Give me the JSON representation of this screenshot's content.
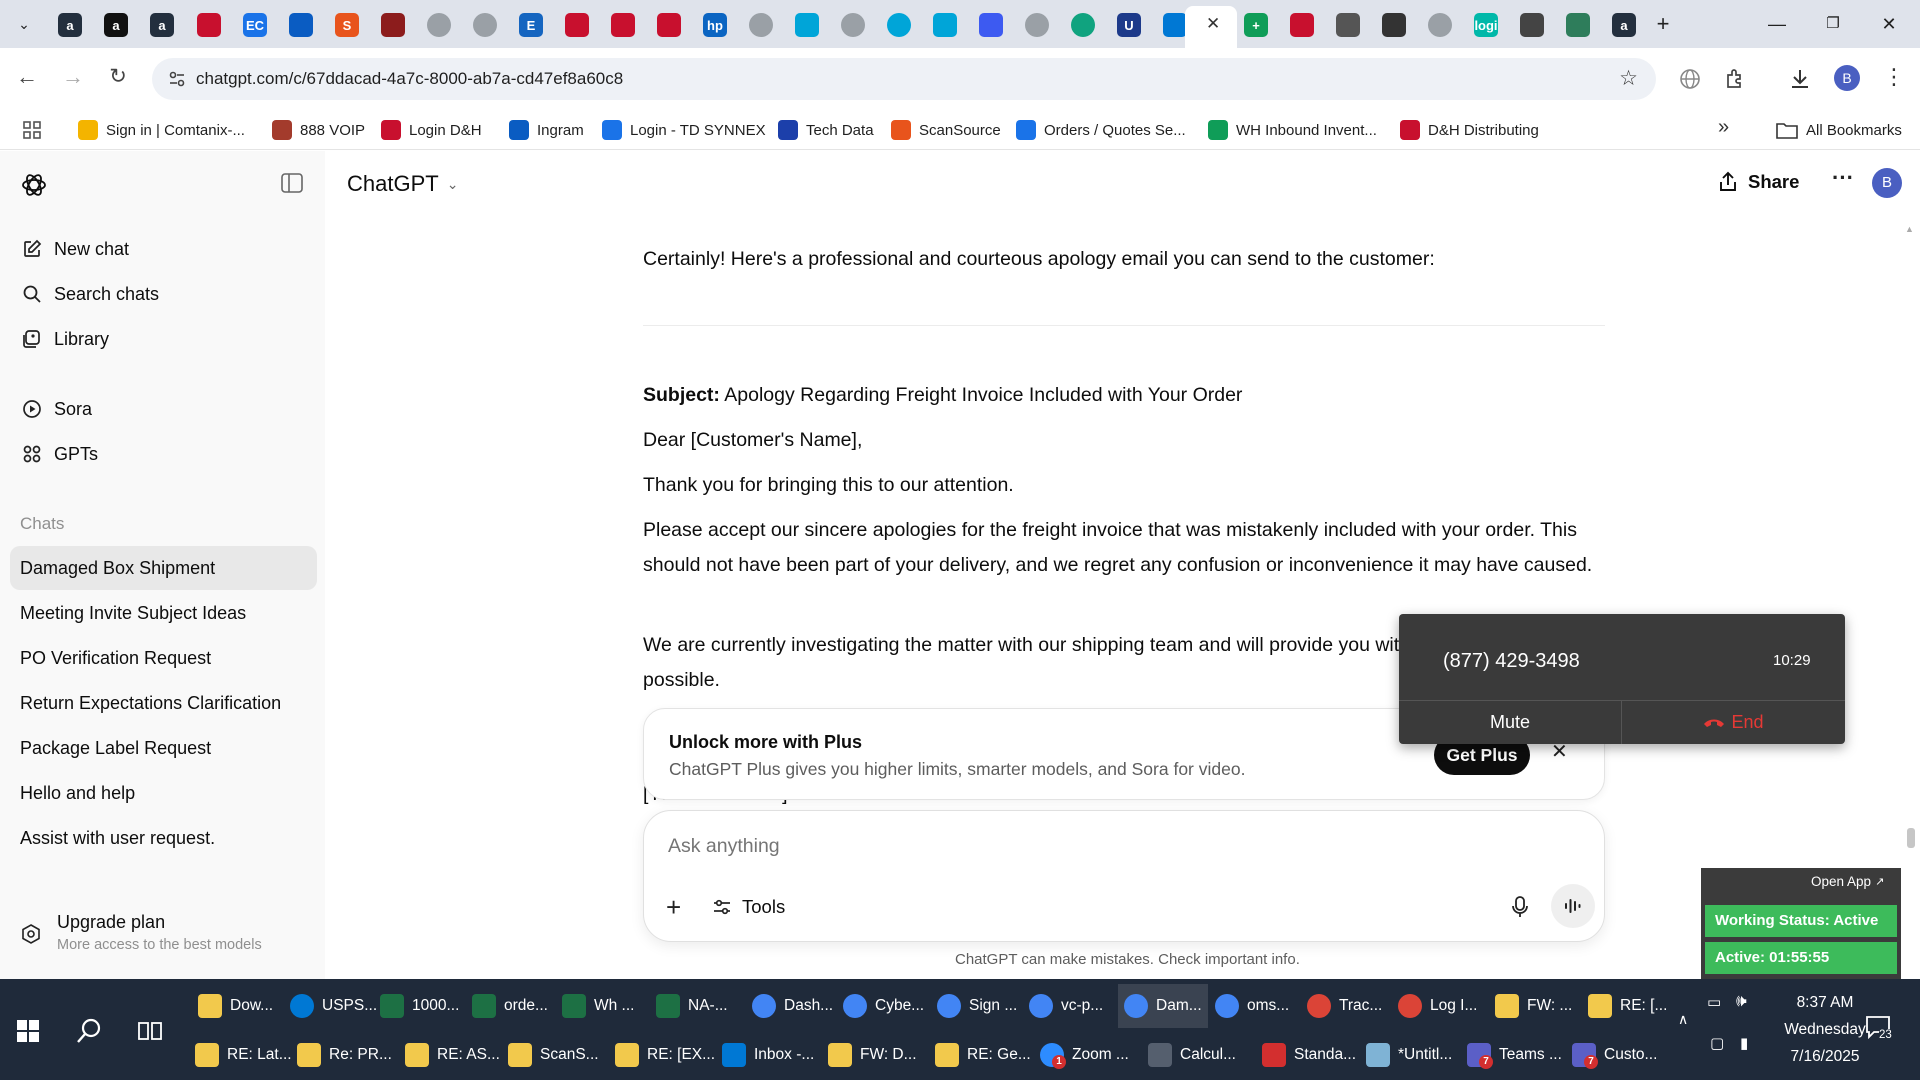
{
  "browser": {
    "url": "chatgpt.com/c/67ddacad-4a7c-8000-ab7a-cd47ef8a60c8",
    "tab_icons": [
      {
        "name": "amazon-icon",
        "color": "#232f3e",
        "glyph": "a"
      },
      {
        "name": "amazon-icon",
        "color": "#111111",
        "glyph": "a"
      },
      {
        "name": "amazon-icon",
        "color": "#232f3e",
        "glyph": "a"
      },
      {
        "name": "dh-icon",
        "color": "#c8102e",
        "glyph": ""
      },
      {
        "name": "ec-icon",
        "color": "#1a73e8",
        "glyph": "EC"
      },
      {
        "name": "ingram-icon",
        "color": "#0a5cc2",
        "glyph": ""
      },
      {
        "name": "scansource-icon",
        "color": "#e8541c",
        "glyph": "S"
      },
      {
        "name": "888voip-icon",
        "color": "#8c1c1c",
        "glyph": ""
      },
      {
        "name": "globe-icon",
        "color": "#7d7d7d",
        "glyph": ""
      },
      {
        "name": "globe-icon",
        "color": "#7d7d7d",
        "glyph": ""
      },
      {
        "name": "edge-icon",
        "color": "#1565c0",
        "glyph": "E"
      },
      {
        "name": "lg-icon",
        "color": "#c8102e",
        "glyph": ""
      },
      {
        "name": "lg-icon",
        "color": "#c8102e",
        "glyph": ""
      },
      {
        "name": "lg-icon",
        "color": "#c8102e",
        "glyph": ""
      },
      {
        "name": "hp-icon",
        "color": "#0b65c2",
        "glyph": "hp"
      },
      {
        "name": "globe-icon",
        "color": "#7d7d7d",
        "glyph": ""
      },
      {
        "name": "td-synnex-icon",
        "color": "#00a5d8",
        "glyph": ""
      },
      {
        "name": "globe-icon",
        "color": "#7d7d7d",
        "glyph": ""
      },
      {
        "name": "circle-icon",
        "color": "#00a5d8",
        "glyph": ""
      },
      {
        "name": "td-synnex-icon",
        "color": "#00a5d8",
        "glyph": ""
      },
      {
        "name": "arrow-icon",
        "color": "#3d5af1",
        "glyph": ""
      },
      {
        "name": "globe-icon",
        "color": "#7d7d7d",
        "glyph": ""
      },
      {
        "name": "circle-icon",
        "color": "#10a37f",
        "glyph": ""
      },
      {
        "name": "u-icon",
        "color": "#1d3a8a",
        "glyph": "U"
      },
      {
        "name": "cloud-icon",
        "color": "#0078d4",
        "glyph": ""
      },
      {
        "name": "chatgpt-tab-icon",
        "color": "#ffffff",
        "glyph": ""
      },
      {
        "name": "sheets-icon",
        "color": "#0f9d58",
        "glyph": "+"
      },
      {
        "name": "dh-icon",
        "color": "#c8102e",
        "glyph": ""
      },
      {
        "name": "crown-icon",
        "color": "#555555",
        "glyph": ""
      },
      {
        "name": "crown-icon",
        "color": "#333333",
        "glyph": ""
      },
      {
        "name": "globe-icon",
        "color": "#7d7d7d",
        "glyph": ""
      },
      {
        "name": "logi-icon",
        "color": "#00b8a9",
        "glyph": "logi"
      },
      {
        "name": "car-icon",
        "color": "#444444",
        "glyph": ""
      },
      {
        "name": "openai-icon",
        "color": "#2e7d5b",
        "glyph": ""
      },
      {
        "name": "amazon-icon",
        "color": "#232f3e",
        "glyph": "a"
      }
    ],
    "bookmarks": [
      {
        "label": "Sign in | Comtanix-...",
        "color": "#f4b400"
      },
      {
        "label": "888 VOIP",
        "color": "#a33b2c"
      },
      {
        "label": "Login D&H",
        "color": "#c8102e"
      },
      {
        "label": "Ingram",
        "color": "#0a5cc2"
      },
      {
        "label": "Login - TD SYNNEX",
        "color": "#1a73e8"
      },
      {
        "label": "Tech Data",
        "color": "#1c3faa"
      },
      {
        "label": "ScanSource",
        "color": "#e8541c"
      },
      {
        "label": "Orders / Quotes Se...",
        "color": "#1a73e8"
      },
      {
        "label": "WH Inbound Invent...",
        "color": "#0f9d58"
      },
      {
        "label": "D&H Distributing",
        "color": "#c8102e"
      }
    ],
    "all_bookmarks": "All Bookmarks",
    "profile_initial": "B"
  },
  "sidebar": {
    "nav": [
      {
        "label": "New chat",
        "icon": "new-chat-icon"
      },
      {
        "label": "Search chats",
        "icon": "search-icon"
      },
      {
        "label": "Library",
        "icon": "library-icon"
      }
    ],
    "apps": [
      {
        "label": "Sora",
        "icon": "sora-icon"
      },
      {
        "label": "GPTs",
        "icon": "gpts-icon"
      }
    ],
    "chats_heading": "Chats",
    "chats": [
      "Damaged Box Shipment",
      "Meeting Invite Subject Ideas",
      "PO Verification Request",
      "Return Expectations Clarification",
      "Package Label Request",
      "Hello and help",
      "Assist with user request."
    ],
    "upgrade_title": "Upgrade plan",
    "upgrade_sub": "More access to the best models"
  },
  "header": {
    "model": "ChatGPT",
    "share": "Share",
    "avatar": "B"
  },
  "conversation": {
    "intro": "Certainly! Here's a professional and courteous apology email you can send to the customer:",
    "subject_label": "Subject:",
    "subject_text": " Apology Regarding Freight Invoice Included with Your Order",
    "greeting": "Dear [Customer's Name],",
    "p1": "Thank you for bringing this to our attention.",
    "p2": "Please accept our sincere apologies for the freight invoice that was mistakenly included with your order. This should not have been part of your delivery, and we regret any confusion or inconvenience it may have caused.",
    "p3": "We are currently investigating the matter with our shipping team and will provide you with an update as soon as possible.",
    "signature": "[Your Full Name]"
  },
  "plus_banner": {
    "title": "Unlock more with Plus",
    "desc": "ChatGPT Plus gives you higher limits, smarter models, and Sora for video.",
    "button": "Get Plus"
  },
  "composer": {
    "placeholder": "Ask anything",
    "tools": "Tools"
  },
  "disclaimer": "ChatGPT can make mistakes. Check important info.",
  "call": {
    "number": "(877) 429-3498",
    "duration": "10:29",
    "mute": "Mute",
    "end": "End",
    "end_color": "#e53935"
  },
  "status_widget": {
    "open_app": "Open App",
    "working": "Working Status: Active",
    "active": "Active: 01:55:55",
    "accent": "#3dbb5b"
  },
  "taskbar": {
    "row1": [
      {
        "label": "Dow...",
        "color": "#f2c94c",
        "icon": "folder-icon"
      },
      {
        "label": "USPS...",
        "color": "#0078d4",
        "icon": "edge-icon"
      },
      {
        "label": "1000...",
        "color": "#1d7044",
        "icon": "excel-icon"
      },
      {
        "label": "orde...",
        "color": "#1d7044",
        "icon": "excel-icon"
      },
      {
        "label": "Wh ...",
        "color": "#1d7044",
        "icon": "excel-icon"
      },
      {
        "label": "NA-...",
        "color": "#1d7044",
        "icon": "excel-icon"
      },
      {
        "label": "Dash...",
        "color": "#4285f4",
        "icon": "chrome-icon"
      },
      {
        "label": "Cybe...",
        "color": "#4285f4",
        "icon": "chrome-icon"
      },
      {
        "label": "Sign ...",
        "color": "#4285f4",
        "icon": "chrome-icon"
      },
      {
        "label": "vc-p...",
        "color": "#4285f4",
        "icon": "chrome-icon"
      },
      {
        "label": "Dam...",
        "color": "#4285f4",
        "icon": "chrome-icon"
      },
      {
        "label": "oms...",
        "color": "#4285f4",
        "icon": "chrome-icon"
      },
      {
        "label": "Trac...",
        "color": "#db4437",
        "icon": "chrome-icon"
      },
      {
        "label": "Log I...",
        "color": "#db4437",
        "icon": "chrome-icon"
      },
      {
        "label": "FW: ...",
        "color": "#f2c94c",
        "icon": "mail-icon"
      },
      {
        "label": "RE: [...",
        "color": "#f2c94c",
        "icon": "mail-icon"
      }
    ],
    "row2": [
      {
        "label": "RE: Lat...",
        "color": "#f2c94c",
        "icon": "mail-icon"
      },
      {
        "label": "Re: PR...",
        "color": "#f2c94c",
        "icon": "mail-icon"
      },
      {
        "label": "RE: AS...",
        "color": "#f2c94c",
        "icon": "mail-icon"
      },
      {
        "label": "ScanS...",
        "color": "#f2c94c",
        "icon": "mail-icon"
      },
      {
        "label": "RE: [EX...",
        "color": "#f2c94c",
        "icon": "mail-icon"
      },
      {
        "label": "Inbox -...",
        "color": "#0078d4",
        "icon": "outlook-icon"
      },
      {
        "label": "FW: D...",
        "color": "#f2c94c",
        "icon": "mail-icon"
      },
      {
        "label": "RE: Ge...",
        "color": "#f2c94c",
        "icon": "mail-icon"
      },
      {
        "label": "Zoom ...",
        "color": "#2d8cff",
        "icon": "zoom-icon"
      },
      {
        "label": "Calcul...",
        "color": "#555f6e",
        "icon": "calculator-icon"
      },
      {
        "label": "Standa...",
        "color": "#d32f2f",
        "icon": "pdf-icon"
      },
      {
        "label": "*Untitl...",
        "color": "#7fb3d5",
        "icon": "notepad-icon"
      },
      {
        "label": "Teams ...",
        "color": "#5b5fc7",
        "icon": "teams-icon"
      },
      {
        "label": "Custo...",
        "color": "#5b5fc7",
        "icon": "teams-icon"
      }
    ],
    "time": "8:37 AM",
    "day": "Wednesday",
    "date": "7/16/2025",
    "notif_count": "23",
    "zoom_badge": "1",
    "teams_badge": "7",
    "teams_badge2": "7"
  }
}
